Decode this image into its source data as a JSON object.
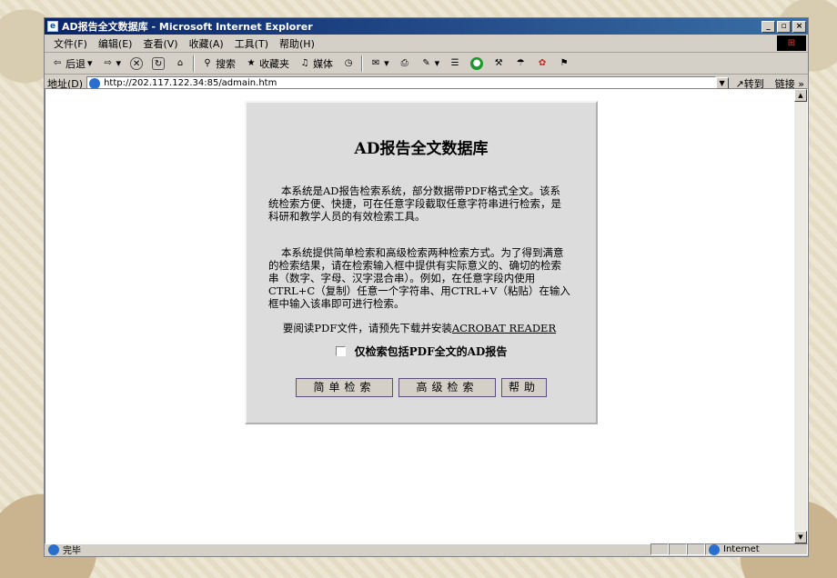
{
  "window": {
    "title": "AD报告全文数据库 - Microsoft Internet Explorer",
    "minimize": "_",
    "restore": "▫",
    "close": "×"
  },
  "menu": [
    "文件(F)",
    "编辑(E)",
    "查看(V)",
    "收藏(A)",
    "工具(T)",
    "帮助(H)"
  ],
  "toolbar": {
    "back": "后退",
    "search": "搜索",
    "favorites": "收藏夹",
    "media": "媒体"
  },
  "address": {
    "label": "地址(D)",
    "url": "http://202.117.122.34:85/admain.htm",
    "go": "转到",
    "links": "链接"
  },
  "page": {
    "heading": "AD报告全文数据库",
    "para1": "本系统是AD报告检索系统，部分数据带PDF格式全文。该系统检索方便、快捷，可在任意字段截取任意字符串进行检索，是科研和教学人员的有效检索工具。",
    "para2": "本系统提供简单检索和高级检索两种检索方式。为了得到满意的检索结果，请在检索输入框中提供有实际意义的、确切的检索串（数字、字母、汉字混合串）。例如，在任意字段内使用CTRL+C（复制）任意一个字符串、用CTRL+V（粘贴）在输入框中输入该串即可进行检索。",
    "para3_prefix": "要阅读PDF文件，请预先下载并安装",
    "acrobat_link": "ACROBAT READER",
    "checkbox_label": "仅检索包括PDF全文的AD报告",
    "buttons": {
      "simple": "简单检索",
      "advanced": "高级检索",
      "help": "帮助"
    }
  },
  "status": {
    "text": "完毕",
    "zone": "Internet"
  }
}
